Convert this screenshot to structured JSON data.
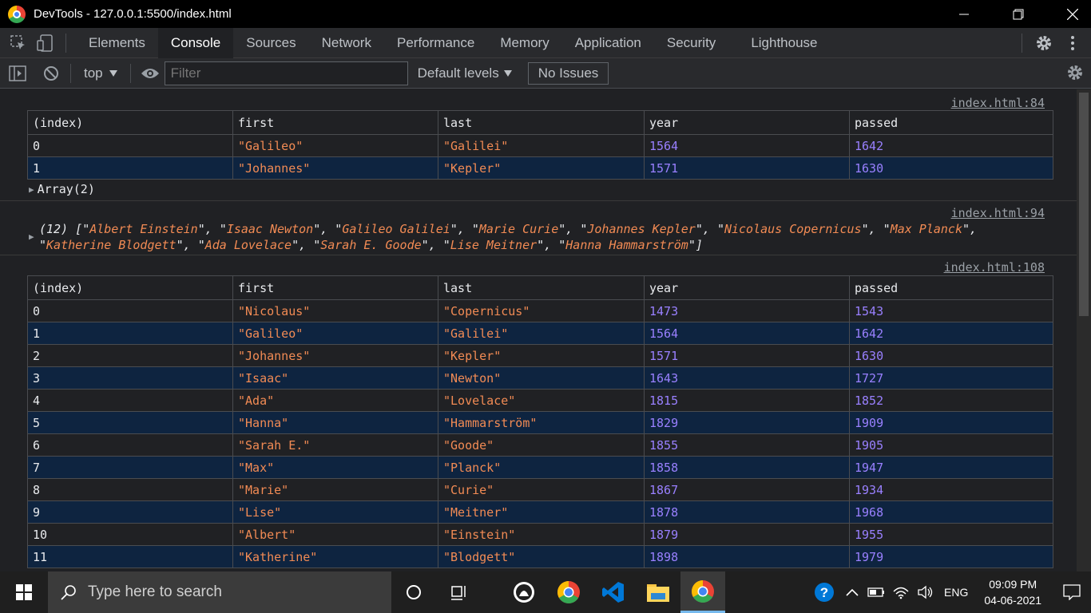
{
  "window": {
    "title": "DevTools - 127.0.0.1:5500/index.html"
  },
  "tabs": [
    "Elements",
    "Console",
    "Sources",
    "Network",
    "Performance",
    "Memory",
    "Application",
    "Security",
    "Lighthouse"
  ],
  "toolbar": {
    "context": "top",
    "filter_placeholder": "Filter",
    "levels": "Default levels",
    "issues": "No Issues"
  },
  "messages": {
    "table1": {
      "source": "index.html:84",
      "headers": [
        "(index)",
        "first",
        "last",
        "year",
        "passed"
      ],
      "rows": [
        [
          "0",
          "\"Galileo\"",
          "\"Galilei\"",
          "1564",
          "1642"
        ],
        [
          "1",
          "\"Johannes\"",
          "\"Kepler\"",
          "1571",
          "1630"
        ]
      ],
      "array_label": "Array(2)"
    },
    "array": {
      "source": "index.html:94",
      "count": "(12)",
      "items": [
        "Albert Einstein",
        "Isaac Newton",
        "Galileo Galilei",
        "Marie Curie",
        "Johannes Kepler",
        "Nicolaus Copernicus",
        "Max Planck",
        "Katherine Blodgett",
        "Ada Lovelace",
        "Sarah E. Goode",
        "Lise Meitner",
        "Hanna Hammarström"
      ]
    },
    "table2": {
      "source": "index.html:108",
      "headers": [
        "(index)",
        "first",
        "last",
        "year",
        "passed"
      ],
      "rows": [
        [
          "0",
          "\"Nicolaus\"",
          "\"Copernicus\"",
          "1473",
          "1543"
        ],
        [
          "1",
          "\"Galileo\"",
          "\"Galilei\"",
          "1564",
          "1642"
        ],
        [
          "2",
          "\"Johannes\"",
          "\"Kepler\"",
          "1571",
          "1630"
        ],
        [
          "3",
          "\"Isaac\"",
          "\"Newton\"",
          "1643",
          "1727"
        ],
        [
          "4",
          "\"Ada\"",
          "\"Lovelace\"",
          "1815",
          "1852"
        ],
        [
          "5",
          "\"Hanna\"",
          "\"Hammarström\"",
          "1829",
          "1909"
        ],
        [
          "6",
          "\"Sarah E.\"",
          "\"Goode\"",
          "1855",
          "1905"
        ],
        [
          "7",
          "\"Max\"",
          "\"Planck\"",
          "1858",
          "1947"
        ],
        [
          "8",
          "\"Marie\"",
          "\"Curie\"",
          "1867",
          "1934"
        ],
        [
          "9",
          "\"Lise\"",
          "\"Meitner\"",
          "1878",
          "1968"
        ],
        [
          "10",
          "\"Albert\"",
          "\"Einstein\"",
          "1879",
          "1955"
        ],
        [
          "11",
          "\"Katherine\"",
          "\"Blodgett\"",
          "1898",
          "1979"
        ]
      ]
    }
  },
  "taskbar": {
    "search_placeholder": "Type here to search",
    "language": "ENG",
    "time": "09:09 PM",
    "date": "04-06-2021"
  }
}
